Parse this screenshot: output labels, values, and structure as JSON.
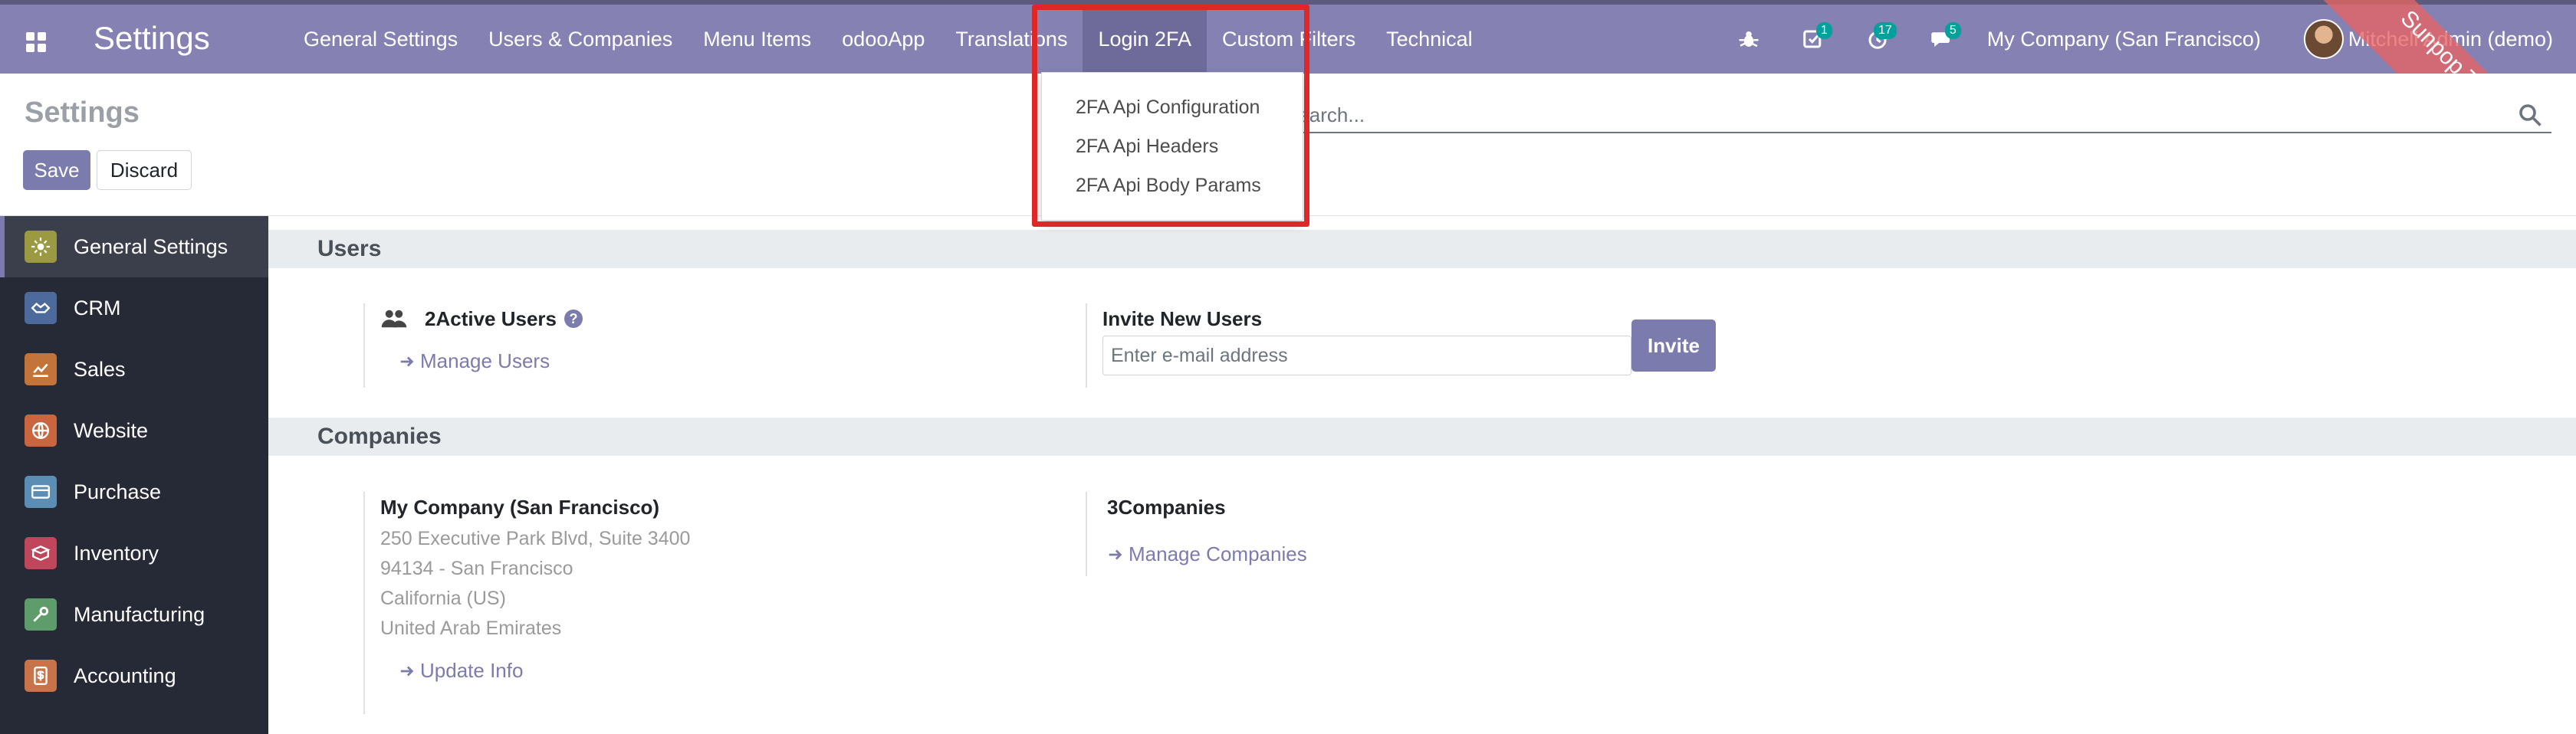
{
  "header": {
    "app_title": "Settings",
    "menu": [
      {
        "label": "General Settings"
      },
      {
        "label": "Users & Companies"
      },
      {
        "label": "Menu Items"
      },
      {
        "label": "odooApp"
      },
      {
        "label": "Translations"
      },
      {
        "label": "Login 2FA",
        "active": true
      },
      {
        "label": "Custom Filters"
      },
      {
        "label": "Technical"
      }
    ],
    "systray": {
      "debug_icon": "bug-icon",
      "activity_badge": "1",
      "timer_badge": "17",
      "messages_badge": "5",
      "company": "My Company (San Francisco)",
      "user_name": "Mitchell Admin (demo)"
    },
    "ribbon_text": "Sunpop Test (demo)"
  },
  "control_panel": {
    "breadcrumb": "Settings",
    "save_label": "Save",
    "discard_label": "Discard",
    "search_placeholder": "Search..."
  },
  "dropdown": {
    "items": [
      {
        "label": "2FA Api Configuration"
      },
      {
        "label": "2FA Api Headers"
      },
      {
        "label": "2FA Api Body Params"
      }
    ]
  },
  "sidebar": {
    "items": [
      {
        "label": "General Settings",
        "icon": "gear-icon",
        "color": "#9b9a43",
        "active": true
      },
      {
        "label": "CRM",
        "icon": "handshake-icon",
        "color": "#4d6a9c"
      },
      {
        "label": "Sales",
        "icon": "chart-icon",
        "color": "#c2743b"
      },
      {
        "label": "Website",
        "icon": "globe-icon",
        "color": "#c9663f"
      },
      {
        "label": "Purchase",
        "icon": "card-icon",
        "color": "#5c8db5"
      },
      {
        "label": "Inventory",
        "icon": "box-icon",
        "color": "#c0475b"
      },
      {
        "label": "Manufacturing",
        "icon": "wrench-icon",
        "color": "#5f9c6b"
      },
      {
        "label": "Accounting",
        "icon": "dollar-icon",
        "color": "#c9734a"
      }
    ]
  },
  "users": {
    "section_title": "Users",
    "active_users": "2Active Users",
    "manage_users": "Manage Users",
    "invite_title": "Invite New Users",
    "invite_placeholder": "Enter e-mail address",
    "invite_button": "Invite"
  },
  "companies": {
    "section_title": "Companies",
    "company_name": "My Company (San Francisco)",
    "address_lines": [
      "250 Executive Park Blvd, Suite 3400",
      "94134 - San Francisco",
      "California (US)",
      "United Arab Emirates"
    ],
    "update_info": "Update Info",
    "companies_count": "3Companies",
    "manage_companies": "Manage Companies"
  },
  "colors": {
    "navbar": "#8582b3",
    "primary": "#7c7bad",
    "sidebar": "#262a36",
    "highlight": "#e02727"
  }
}
